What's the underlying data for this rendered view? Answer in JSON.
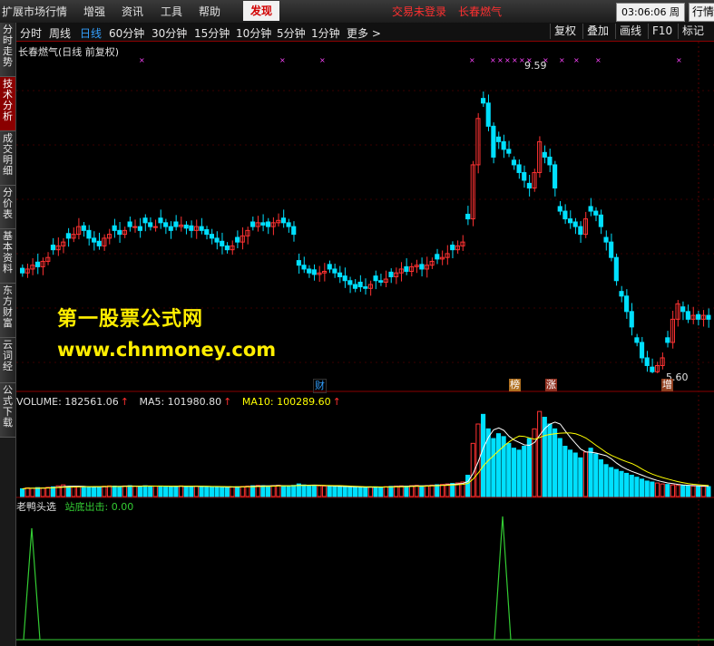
{
  "menu": {
    "items": [
      "扩展市场行情",
      "增强",
      "资讯",
      "工具",
      "帮助"
    ],
    "discover": "发现",
    "login_status": "交易未登录",
    "stock_name_top": "长春燃气",
    "clock": "03:06:06",
    "weekday": "周四",
    "market_button": "行情"
  },
  "sidebar": {
    "tabs": [
      "分时走势",
      "技术分析",
      "成交明细",
      "分价表",
      "基本资料",
      "东方财富",
      "云词经",
      "公式下载"
    ],
    "active_index": 1
  },
  "toolbar": {
    "timeframes": [
      "分时",
      "周线",
      "日线",
      "60分钟",
      "30分钟",
      "15分钟",
      "10分钟",
      "5分钟",
      "1分钟",
      "更多 >"
    ],
    "active_timeframe": "日线",
    "buttons": [
      "复权",
      "叠加",
      "画线",
      "F10",
      "标记"
    ]
  },
  "main_chart": {
    "title": "长春燃气(日线 前复权)",
    "high_label": "9.59",
    "low_label": "5.60",
    "events": [
      "财",
      "榜",
      "涨",
      "增"
    ],
    "colors": {
      "up": "#ff3232",
      "down": "#00e0ff",
      "ma5": "#ffffff",
      "ma10": "#ffff00",
      "signal": "#33cc33",
      "marker": "#ff44ff"
    }
  },
  "watermark": {
    "line1": "第一股票公式网",
    "line2": "www.chnmoney.com"
  },
  "volume": {
    "label": "VOLUME: 182561.06",
    "ma5_label": "MA5: 101980.80",
    "ma10_label": "MA10: 100289.60",
    "arrow": "↑"
  },
  "indicator": {
    "name": "老鸭头选",
    "signal_label": "站底出击: 0.00"
  },
  "chart_data": {
    "type": "candlestick",
    "ylim": [
      5.6,
      9.59
    ],
    "close": [
      6.9,
      6.95,
      7.0,
      6.98,
      7.05,
      7.1,
      7.2,
      7.25,
      7.3,
      7.35,
      7.4,
      7.5,
      7.45,
      7.35,
      7.3,
      7.25,
      7.35,
      7.4,
      7.45,
      7.4,
      7.45,
      7.5,
      7.5,
      7.45,
      7.55,
      7.5,
      7.5,
      7.55,
      7.5,
      7.45,
      7.5,
      7.52,
      7.48,
      7.45,
      7.5,
      7.45,
      7.4,
      7.35,
      7.3,
      7.25,
      7.2,
      7.25,
      7.3,
      7.38,
      7.45,
      7.5,
      7.55,
      7.52,
      7.5,
      7.55,
      7.58,
      7.55,
      7.5,
      7.4,
      7.0,
      6.95,
      6.9,
      6.88,
      6.9,
      6.92,
      6.95,
      6.9,
      6.85,
      6.8,
      6.75,
      6.7,
      6.72,
      6.7,
      6.75,
      6.8,
      6.78,
      6.82,
      6.85,
      6.9,
      6.95,
      6.92,
      6.98,
      7.0,
      6.95,
      7.0,
      7.05,
      7.08,
      7.1,
      7.15,
      7.2,
      7.25,
      7.3,
      7.6,
      8.3,
      8.9,
      9.1,
      8.8,
      8.4,
      8.6,
      8.5,
      8.45,
      8.3,
      8.2,
      8.1,
      8.0,
      8.2,
      8.6,
      8.4,
      8.3,
      8.0,
      7.7,
      7.6,
      7.55,
      7.5,
      7.4,
      7.6,
      7.7,
      7.65,
      7.5,
      7.3,
      7.1,
      6.8,
      6.6,
      6.4,
      6.2,
      6.0,
      5.8,
      5.7,
      5.62,
      5.7,
      5.8,
      6.0,
      6.3,
      6.5,
      6.4,
      6.3,
      6.35,
      6.3,
      6.35,
      6.3
    ],
    "volume": [
      8000,
      9000,
      8500,
      9200,
      8800,
      9500,
      10000,
      11000,
      12000,
      10500,
      9800,
      10200,
      9900,
      10100,
      9700,
      10300,
      10600,
      11000,
      10800,
      10400,
      10900,
      11200,
      10700,
      10500,
      11100,
      10800,
      10600,
      10900,
      10400,
      10200,
      10700,
      11000,
      10500,
      10300,
      10800,
      10600,
      10100,
      9900,
      9800,
      9600,
      9700,
      9900,
      10100,
      10400,
      10800,
      11100,
      11500,
      11200,
      10900,
      11300,
      11600,
      11000,
      10800,
      11500,
      13000,
      12000,
      11500,
      11200,
      11000,
      10800,
      10600,
      10400,
      10200,
      10000,
      9800,
      9600,
      9700,
      9500,
      9800,
      10000,
      9900,
      10200,
      10500,
      10800,
      11000,
      10700,
      11200,
      11500,
      11000,
      11300,
      11800,
      12200,
      12500,
      13000,
      13500,
      14000,
      15000,
      22000,
      55000,
      75000,
      85000,
      70000,
      60000,
      65000,
      62000,
      55000,
      50000,
      48000,
      52000,
      60000,
      70000,
      88000,
      82000,
      75000,
      70000,
      60000,
      52000,
      48000,
      45000,
      40000,
      46000,
      50000,
      44000,
      38000,
      33000,
      30000,
      28000,
      26000,
      24000,
      22000,
      20000,
      18000,
      16000,
      15000,
      14000,
      13000,
      12500,
      12000,
      11500,
      11200,
      11000,
      10800,
      10600,
      10500,
      10300
    ]
  }
}
